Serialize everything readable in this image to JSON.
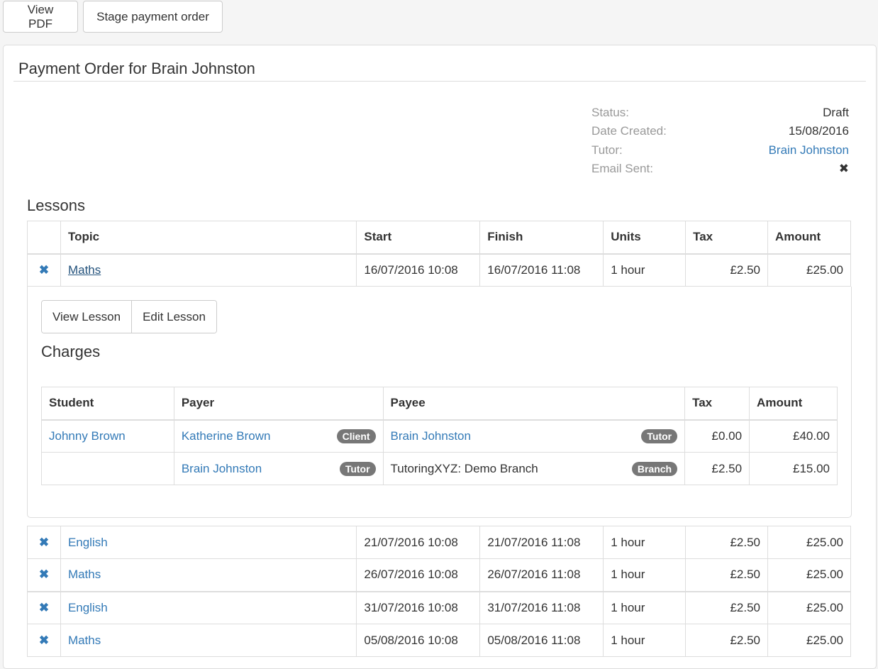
{
  "toolbar": {
    "view_pdf": "View PDF",
    "stage_payment_order": "Stage payment order"
  },
  "panel": {
    "title": "Payment Order for Brain Johnston",
    "meta": [
      {
        "label": "Status:",
        "value": "Draft"
      },
      {
        "label": "Date Created:",
        "value": "15/08/2016"
      },
      {
        "label": "Tutor:",
        "value": "Brain Johnston"
      },
      {
        "label": "Email Sent:",
        "value": "✖"
      }
    ]
  },
  "lessons": {
    "heading": "Lessons",
    "columns": [
      "",
      "Topic",
      "Start",
      "Finish",
      "Units",
      "Tax",
      "Amount"
    ],
    "rows": [
      {
        "icon": "✖",
        "topic": "Maths",
        "start": "16/07/2016 10:08",
        "finish": "16/07/2016 11:08",
        "units": "1 hour",
        "tax": "£2.50",
        "amount": "£25.00"
      },
      {
        "icon": "✖",
        "topic": "English",
        "start": "21/07/2016 10:08",
        "finish": "21/07/2016 11:08",
        "units": "1 hour",
        "tax": "£2.50",
        "amount": "£25.00"
      },
      {
        "icon": "✖",
        "topic": "Maths",
        "start": "26/07/2016 10:08",
        "finish": "26/07/2016 11:08",
        "units": "1 hour",
        "tax": "£2.50",
        "amount": "£25.00"
      },
      {
        "icon": "✖",
        "topic": "English",
        "start": "31/07/2016 10:08",
        "finish": "31/07/2016 11:08",
        "units": "1 hour",
        "tax": "£2.50",
        "amount": "£25.00"
      },
      {
        "icon": "✖",
        "topic": "Maths",
        "start": "05/08/2016 10:08",
        "finish": "05/08/2016 11:08",
        "units": "1 hour",
        "tax": "£2.50",
        "amount": "£25.00"
      }
    ]
  },
  "detail": {
    "view_lesson": "View Lesson",
    "edit_lesson": "Edit Lesson",
    "charges_heading": "Charges",
    "charges_columns": [
      "Student",
      "Payer",
      "Payee",
      "Tax",
      "Amount"
    ],
    "charges": [
      {
        "student": "Johnny Brown",
        "payer": "Katherine Brown",
        "payer_badge": "Client",
        "payee": "Brain Johnston",
        "payee_badge": "Tutor",
        "tax": "£0.00",
        "amount": "£40.00"
      },
      {
        "student": "",
        "payer": "Brain Johnston",
        "payer_badge": "Tutor",
        "payee": "TutoringXYZ: Demo Branch",
        "payee_badge": "Branch",
        "tax": "£2.50",
        "amount": "£15.00"
      }
    ]
  }
}
